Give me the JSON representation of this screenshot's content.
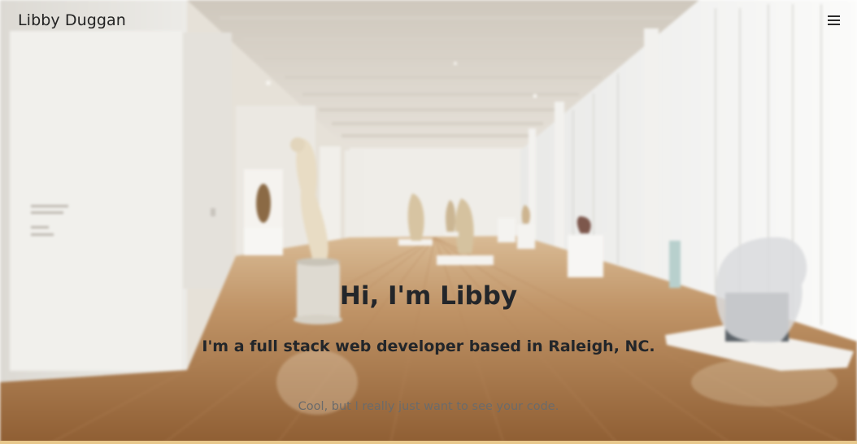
{
  "navbar": {
    "brand": "Libby Duggan",
    "menu_icon": "hamburger-menu-icon"
  },
  "hero": {
    "title": "Hi, I'm Libby",
    "subtitle": "I'm a full stack web developer based in Raleigh, NC.",
    "code_link": "Cool, but I really just want to see your code."
  },
  "colors": {
    "text_dark": "#23262a",
    "link_muted": "#6b6b6b",
    "floor": "#a9784a",
    "wall": "#ece7df",
    "accent_strip": "#e8c88c"
  }
}
